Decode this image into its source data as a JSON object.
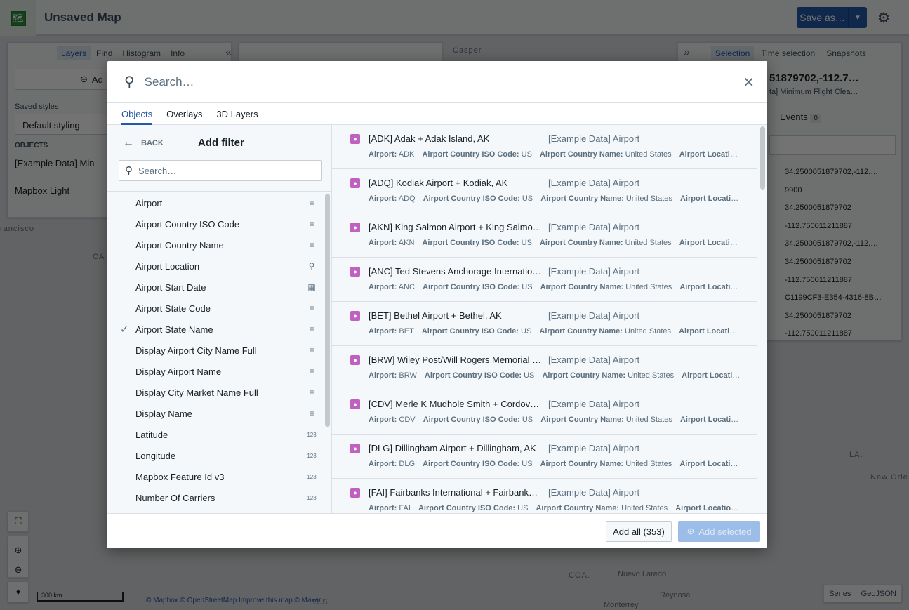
{
  "app": {
    "title": "Unsaved Map",
    "save_label": "Save as…",
    "settings_icon": "gear-icon"
  },
  "left_panel": {
    "tabs": [
      "Layers",
      "Find",
      "Histogram",
      "Info"
    ],
    "add_label": "Ad",
    "saved_styles_label": "Saved styles",
    "saved_style_value": "Default styling",
    "objects_header": "OBJECTS",
    "object_layer": "[Example Data] Min",
    "basemap": "Mapbox Light"
  },
  "right_panel": {
    "tabs": [
      "Selection",
      "Time selection",
      "Snapshots"
    ],
    "title": "51879702,-112.7…",
    "subtitle": "ta] Minimum Flight Clea…",
    "events_label": "Events",
    "events_count": "0",
    "values": [
      "34.2500051879702,-112.…",
      "9900",
      "34.2500051879702",
      "-112.750011211887",
      "34.2500051879702,-112.…",
      "34.2500051879702",
      "-112.750011211887",
      "C1199CF3-E354-4316-8B…",
      "34.2500051879702",
      "-112.750011211887"
    ]
  },
  "map": {
    "labels": [
      "Casper",
      "rancisco",
      "CA",
      "LA.",
      "New Orle",
      "COA.",
      "Nuevo Laredo",
      "Reynosa",
      "Monterrey",
      "C.S"
    ],
    "scale": "300 km",
    "attribution": "© Mapbox © OpenStreetMap Improve this map © Maxar",
    "export_buttons": [
      "Series",
      "GeoJSON"
    ]
  },
  "modal": {
    "search_placeholder": "Search…",
    "tabs": [
      "Objects",
      "Overlays",
      "3D Layers"
    ],
    "active_tab": "Objects",
    "back_label": "BACK",
    "filter_title": "Add filter",
    "filter_search_placeholder": "Search…",
    "properties": [
      {
        "name": "Airport",
        "type": "text",
        "checked": false
      },
      {
        "name": "Airport Country ISO Code",
        "type": "text",
        "checked": false
      },
      {
        "name": "Airport Country Name",
        "type": "text",
        "checked": false
      },
      {
        "name": "Airport Location",
        "type": "geo",
        "checked": false
      },
      {
        "name": "Airport Start Date",
        "type": "date",
        "checked": false
      },
      {
        "name": "Airport State Code",
        "type": "text",
        "checked": false
      },
      {
        "name": "Airport State Name",
        "type": "text",
        "checked": true
      },
      {
        "name": "Display Airport City Name Full",
        "type": "text",
        "checked": false
      },
      {
        "name": "Display Airport Name",
        "type": "text",
        "checked": false
      },
      {
        "name": "Display City Market Name Full",
        "type": "text",
        "checked": false
      },
      {
        "name": "Display Name",
        "type": "text",
        "checked": false
      },
      {
        "name": "Latitude",
        "type": "number",
        "checked": false
      },
      {
        "name": "Longitude",
        "type": "number",
        "checked": false
      },
      {
        "name": "Mapbox Feature Id v3",
        "type": "number",
        "checked": false
      },
      {
        "name": "Number Of Carriers",
        "type": "number",
        "checked": false
      }
    ],
    "results": [
      {
        "title": "[ADK] Adak + Adak Island, AK",
        "type": "[Example Data] Airport",
        "code": "ADK",
        "iso": "US",
        "country": "United States",
        "loc": "Airport Location…"
      },
      {
        "title": "[ADQ] Kodiak Airport + Kodiak, AK",
        "type": "[Example Data] Airport",
        "code": "ADQ",
        "iso": "US",
        "country": "United States",
        "loc": "Airport Location…"
      },
      {
        "title": "[AKN] King Salmon Airport + King Salmo…",
        "type": "[Example Data] Airport",
        "code": "AKN",
        "iso": "US",
        "country": "United States",
        "loc": "Airport Location…"
      },
      {
        "title": "[ANC] Ted Stevens Anchorage Internatio…",
        "type": "[Example Data] Airport",
        "code": "ANC",
        "iso": "US",
        "country": "United States",
        "loc": "Airport Location…"
      },
      {
        "title": "[BET] Bethel Airport + Bethel, AK",
        "type": "[Example Data] Airport",
        "code": "BET",
        "iso": "US",
        "country": "United States",
        "loc": "Airport Location:…"
      },
      {
        "title": "[BRW] Wiley Post/Will Rogers Memorial …",
        "type": "[Example Data] Airport",
        "code": "BRW",
        "iso": "US",
        "country": "United States",
        "loc": "Airport Locatio…"
      },
      {
        "title": "[CDV] Merle K Mudhole Smith + Cordova…",
        "type": "[Example Data] Airport",
        "code": "CDV",
        "iso": "US",
        "country": "United States",
        "loc": "Airport Location…"
      },
      {
        "title": "[DLG] Dillingham Airport + Dillingham, AK",
        "type": "[Example Data] Airport",
        "code": "DLG",
        "iso": "US",
        "country": "United States",
        "loc": "Airport Location…"
      },
      {
        "title": "[FAI] Fairbanks International + Fairbank…",
        "type": "[Example Data] Airport",
        "code": "FAI",
        "iso": "US",
        "country": "United States",
        "loc": "Airport Location:…"
      }
    ],
    "prop_labels": {
      "airport": "Airport:",
      "iso": "Airport Country ISO Code:",
      "country": "Airport Country Name:"
    },
    "add_all_label": "Add all (353)",
    "add_selected_label": "Add selected"
  }
}
